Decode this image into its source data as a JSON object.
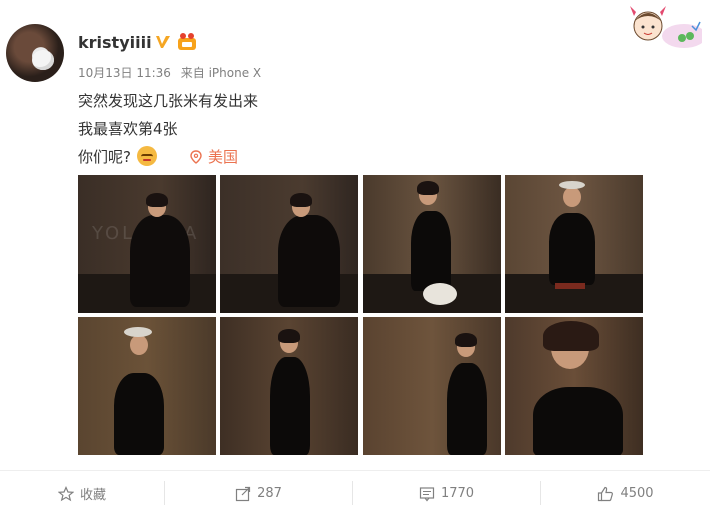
{
  "post": {
    "username": "kristyiiii",
    "date": "10月13日 11:36",
    "source": "来自 iPhone X",
    "lines": [
      "突然发现这几张米有发出来",
      "我最喜欢第4张",
      "你们呢?"
    ],
    "location": "美国"
  },
  "photos": [
    {
      "label": "photo-1"
    },
    {
      "label": "photo-2"
    },
    {
      "label": "photo-3"
    },
    {
      "label": "photo-4"
    },
    {
      "label": "photo-5"
    },
    {
      "label": "photo-6"
    },
    {
      "label": "photo-7"
    },
    {
      "label": "photo-8"
    }
  ],
  "actions": {
    "favorite": "收藏",
    "repost": "287",
    "comment": "1770",
    "like": "4500"
  },
  "colors": {
    "location": "#eb7350",
    "meta": "#808080",
    "verify": "#f5a623"
  }
}
